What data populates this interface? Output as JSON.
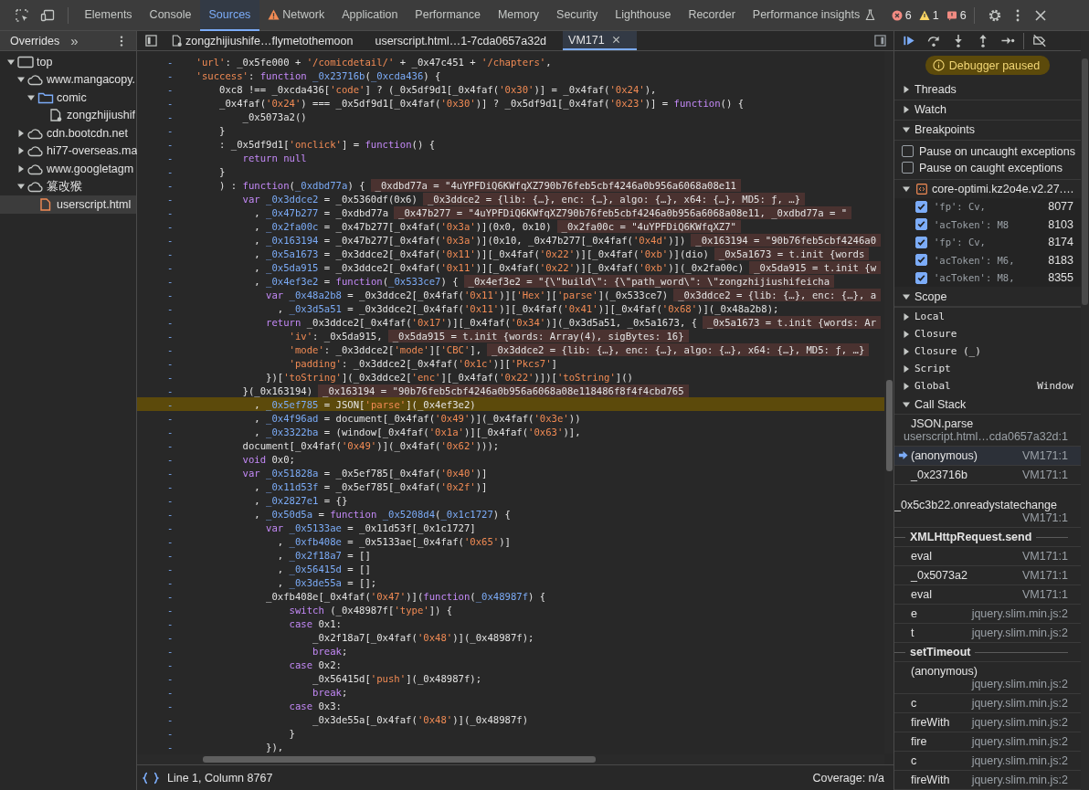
{
  "toolbar": {
    "tabs": [
      {
        "label": "Elements",
        "selected": false,
        "warning": false
      },
      {
        "label": "Console",
        "selected": false,
        "warning": false
      },
      {
        "label": "Sources",
        "selected": true,
        "warning": false
      },
      {
        "label": "Network",
        "selected": false,
        "warning": true
      },
      {
        "label": "Application",
        "selected": false,
        "warning": false
      },
      {
        "label": "Performance",
        "selected": false,
        "warning": false
      },
      {
        "label": "Memory",
        "selected": false,
        "warning": false
      },
      {
        "label": "Security",
        "selected": false,
        "warning": false
      },
      {
        "label": "Lighthouse",
        "selected": false,
        "warning": false
      },
      {
        "label": "Recorder",
        "selected": false,
        "warning": false
      },
      {
        "label": "Performance insights",
        "selected": false,
        "warning": false
      }
    ],
    "counters": [
      {
        "kind": "error",
        "count": "6"
      },
      {
        "kind": "warning",
        "count": "1"
      },
      {
        "kind": "issue",
        "count": "6"
      }
    ]
  },
  "navigator": {
    "tab": "Overrides",
    "more": "»",
    "tree": [
      {
        "label": "top",
        "kind": "frame",
        "expanded": true,
        "selected": false,
        "children": [
          {
            "label": "www.mangacopy.",
            "kind": "cloud",
            "expanded": true,
            "selected": false,
            "children": [
              {
                "label": "comic",
                "kind": "folder",
                "expanded": true,
                "selected": false,
                "children": [
                  {
                    "label": "zongzhijiushif",
                    "kind": "file",
                    "selected": false
                  }
                ]
              }
            ]
          },
          {
            "label": "cdn.bootcdn.net",
            "kind": "cloud",
            "expanded": false,
            "selected": false
          },
          {
            "label": "hi77-overseas.ma",
            "kind": "cloud",
            "expanded": false,
            "selected": false
          },
          {
            "label": "www.googletagm",
            "kind": "cloud",
            "expanded": false,
            "selected": false
          },
          {
            "label": "篡改猴",
            "kind": "cloud",
            "expanded": true,
            "selected": false,
            "children": [
              {
                "label": "userscript.html",
                "kind": "script",
                "selected": true
              }
            ]
          }
        ]
      }
    ]
  },
  "editor": {
    "tabs": [
      {
        "label": "zongzhijiushife…flymetothemoon",
        "kind": "file",
        "selected": false
      },
      {
        "label": "userscript.html…1-7cda0657a32d",
        "kind": "plain",
        "selected": false
      },
      {
        "label": "VM171",
        "kind": "plain",
        "selected": true
      }
    ],
    "lines": [
      {
        "gutter": "-",
        "paused": false,
        "segs": [
          {
            "kind": "string",
            "text": "    'url'"
          },
          {
            "kind": "plain",
            "text": ": _0x5fe000 + "
          },
          {
            "kind": "string",
            "text": "'/comicdetail/'"
          },
          {
            "kind": "plain",
            "text": " + _0x47c451 + "
          },
          {
            "kind": "string",
            "text": "'/chapters'"
          },
          {
            "kind": "plain",
            "text": ","
          }
        ]
      },
      {
        "gutter": "-",
        "paused": false,
        "segs": [
          {
            "kind": "string",
            "text": "    'success'"
          },
          {
            "kind": "plain",
            "text": ": "
          },
          {
            "kind": "keyword",
            "text": "function"
          },
          {
            "kind": "name",
            "text": " _0x23716b"
          },
          {
            "kind": "plain",
            "text": "("
          },
          {
            "kind": "name",
            "text": "_0xcda436"
          },
          {
            "kind": "plain",
            "text": ") {"
          }
        ]
      },
      {
        "gutter": "-",
        "paused": false,
        "segs": [
          {
            "kind": "plain",
            "text": "        0xc8 !== _0xcda436["
          },
          {
            "kind": "string",
            "text": "'code'"
          },
          {
            "kind": "plain",
            "text": "] ? (_0x5df9d1[_0x4faf("
          },
          {
            "kind": "string",
            "text": "'0x30'"
          },
          {
            "kind": "plain",
            "text": ")] = _0x4faf("
          },
          {
            "kind": "string",
            "text": "'0x24'"
          },
          {
            "kind": "plain",
            "text": "),"
          }
        ]
      },
      {
        "gutter": "-",
        "paused": false,
        "segs": [
          {
            "kind": "plain",
            "text": "        _0x4faf("
          },
          {
            "kind": "string",
            "text": "'0x24'"
          },
          {
            "kind": "plain",
            "text": ") === _0x5df9d1[_0x4faf("
          },
          {
            "kind": "string",
            "text": "'0x30'"
          },
          {
            "kind": "plain",
            "text": ")] ? _0x5df9d1[_0x4faf("
          },
          {
            "kind": "string",
            "text": "'0x23'"
          },
          {
            "kind": "plain",
            "text": ")] = "
          },
          {
            "kind": "keyword",
            "text": "function"
          },
          {
            "kind": "plain",
            "text": "() {"
          }
        ]
      },
      {
        "gutter": "-",
        "paused": false,
        "segs": [
          {
            "kind": "plain",
            "text": "            _0x5073a2()"
          }
        ]
      },
      {
        "gutter": "-",
        "paused": false,
        "segs": [
          {
            "kind": "plain",
            "text": "        }"
          }
        ]
      },
      {
        "gutter": "-",
        "paused": false,
        "segs": [
          {
            "kind": "plain",
            "text": "        : _0x5df9d1["
          },
          {
            "kind": "string",
            "text": "'onclick'"
          },
          {
            "kind": "plain",
            "text": "] = "
          },
          {
            "kind": "keyword",
            "text": "function"
          },
          {
            "kind": "plain",
            "text": "() {"
          }
        ]
      },
      {
        "gutter": "-",
        "paused": false,
        "segs": [
          {
            "kind": "keyword",
            "text": "            return null"
          }
        ]
      },
      {
        "gutter": "-",
        "paused": false,
        "segs": [
          {
            "kind": "plain",
            "text": "        }"
          }
        ]
      },
      {
        "gutter": "-",
        "paused": false,
        "segs": [
          {
            "kind": "plain",
            "text": "        ) : "
          },
          {
            "kind": "keyword",
            "text": "function"
          },
          {
            "kind": "plain",
            "text": "("
          },
          {
            "kind": "name",
            "text": "_0xdbd77a"
          },
          {
            "kind": "plain",
            "text": ") {"
          }
        ],
        "inline": "_0xdbd77a = \"4uYPFDiQ6KWfqXZ790b76feb5cbf4246a0b956a6068a08e11"
      },
      {
        "gutter": "-",
        "paused": false,
        "segs": [
          {
            "kind": "keyword",
            "text": "            var"
          },
          {
            "kind": "name",
            "text": " _0x3ddce2"
          },
          {
            "kind": "plain",
            "text": " = _0x5360df(0x6)"
          }
        ],
        "inline": "_0x3ddce2 = {lib: {…}, enc: {…}, algo: {…}, x64: {…}, MD5: ƒ, …}"
      },
      {
        "gutter": "-",
        "paused": false,
        "segs": [
          {
            "kind": "plain",
            "text": "              , "
          },
          {
            "kind": "name",
            "text": "_0x47b277"
          },
          {
            "kind": "plain",
            "text": " = _0xdbd77a"
          }
        ],
        "inline": "_0x47b277 = \"4uYPFDiQ6KWfqXZ790b76feb5cbf4246a0b956a6068a08e11, _0xdbd77a = \""
      },
      {
        "gutter": "-",
        "paused": false,
        "segs": [
          {
            "kind": "plain",
            "text": "              , "
          },
          {
            "kind": "name",
            "text": "_0x2fa00c"
          },
          {
            "kind": "plain",
            "text": " = _0x47b277[_0x4faf("
          },
          {
            "kind": "string",
            "text": "'0x3a'"
          },
          {
            "kind": "plain",
            "text": ")](0x0, 0x10)"
          }
        ],
        "inline": "_0x2fa00c = \"4uYPFDiQ6KWfqXZ7\""
      },
      {
        "gutter": "-",
        "paused": false,
        "segs": [
          {
            "kind": "plain",
            "text": "              , "
          },
          {
            "kind": "name",
            "text": "_0x163194"
          },
          {
            "kind": "plain",
            "text": " = _0x47b277[_0x4faf("
          },
          {
            "kind": "string",
            "text": "'0x3a'"
          },
          {
            "kind": "plain",
            "text": ")](0x10, _0x47b277[_0x4faf("
          },
          {
            "kind": "string",
            "text": "'0x4d'"
          },
          {
            "kind": "plain",
            "text": ")])"
          }
        ],
        "inline": "_0x163194 = \"90b76feb5cbf4246a0"
      },
      {
        "gutter": "-",
        "paused": false,
        "segs": [
          {
            "kind": "plain",
            "text": "              , "
          },
          {
            "kind": "name",
            "text": "_0x5a1673"
          },
          {
            "kind": "plain",
            "text": " = _0x3ddce2[_0x4faf("
          },
          {
            "kind": "string",
            "text": "'0x11'"
          },
          {
            "kind": "plain",
            "text": ")][_0x4faf("
          },
          {
            "kind": "string",
            "text": "'0x22'"
          },
          {
            "kind": "plain",
            "text": ")][_0x4faf("
          },
          {
            "kind": "string",
            "text": "'0xb'"
          },
          {
            "kind": "plain",
            "text": ")](dio)"
          }
        ],
        "inline": "_0x5a1673 = t.init {words"
      },
      {
        "gutter": "-",
        "paused": false,
        "segs": [
          {
            "kind": "plain",
            "text": "              , "
          },
          {
            "kind": "name",
            "text": "_0x5da915"
          },
          {
            "kind": "plain",
            "text": " = _0x3ddce2[_0x4faf("
          },
          {
            "kind": "string",
            "text": "'0x11'"
          },
          {
            "kind": "plain",
            "text": ")][_0x4faf("
          },
          {
            "kind": "string",
            "text": "'0x22'"
          },
          {
            "kind": "plain",
            "text": ")][_0x4faf("
          },
          {
            "kind": "string",
            "text": "'0xb'"
          },
          {
            "kind": "plain",
            "text": ")](_0x2fa00c)"
          }
        ],
        "inline": "_0x5da915 = t.init {w"
      },
      {
        "gutter": "-",
        "paused": false,
        "segs": [
          {
            "kind": "plain",
            "text": "              , "
          },
          {
            "kind": "name",
            "text": "_0x4ef3e2"
          },
          {
            "kind": "plain",
            "text": " = "
          },
          {
            "kind": "keyword",
            "text": "function"
          },
          {
            "kind": "plain",
            "text": "("
          },
          {
            "kind": "name",
            "text": "_0x533ce7"
          },
          {
            "kind": "plain",
            "text": ") {"
          }
        ],
        "inline": "_0x4ef3e2 = \"{\\\"build\\\": {\\\"path_word\\\": \\\"zongzhijiushifeicha"
      },
      {
        "gutter": "-",
        "paused": false,
        "segs": [
          {
            "kind": "keyword",
            "text": "                var"
          },
          {
            "kind": "name",
            "text": " _0x48a2b8"
          },
          {
            "kind": "plain",
            "text": " = _0x3ddce2[_0x4faf("
          },
          {
            "kind": "string",
            "text": "'0x11'"
          },
          {
            "kind": "plain",
            "text": ")]["
          },
          {
            "kind": "string",
            "text": "'Hex'"
          },
          {
            "kind": "plain",
            "text": "]["
          },
          {
            "kind": "string",
            "text": "'parse'"
          },
          {
            "kind": "plain",
            "text": "](_0x533ce7)"
          }
        ],
        "inline": "_0x3ddce2 = {lib: {…}, enc: {…}, a"
      },
      {
        "gutter": "-",
        "paused": false,
        "segs": [
          {
            "kind": "plain",
            "text": "                  , "
          },
          {
            "kind": "name",
            "text": "_0x3d5a51"
          },
          {
            "kind": "plain",
            "text": " = _0x3ddce2[_0x4faf("
          },
          {
            "kind": "string",
            "text": "'0x11'"
          },
          {
            "kind": "plain",
            "text": ")][_0x4faf("
          },
          {
            "kind": "string",
            "text": "'0x41'"
          },
          {
            "kind": "plain",
            "text": ")][_0x4faf("
          },
          {
            "kind": "string",
            "text": "'0x68'"
          },
          {
            "kind": "plain",
            "text": ")](_0x48a2b8);"
          }
        ]
      },
      {
        "gutter": "-",
        "paused": false,
        "segs": [
          {
            "kind": "keyword",
            "text": "                return"
          },
          {
            "kind": "plain",
            "text": " _0x3ddce2[_0x4faf("
          },
          {
            "kind": "string",
            "text": "'0x17'"
          },
          {
            "kind": "plain",
            "text": ")][_0x4faf("
          },
          {
            "kind": "string",
            "text": "'0x34'"
          },
          {
            "kind": "plain",
            "text": ")](_0x3d5a51, _0x5a1673, {"
          }
        ],
        "inline": "_0x5a1673 = t.init {words: Ar"
      },
      {
        "gutter": "-",
        "paused": false,
        "segs": [
          {
            "kind": "string",
            "text": "                    'iv'"
          },
          {
            "kind": "plain",
            "text": ": _0x5da915,"
          }
        ],
        "inline": "_0x5da915 = t.init {words: Array(4), sigBytes: 16}"
      },
      {
        "gutter": "-",
        "paused": false,
        "segs": [
          {
            "kind": "string",
            "text": "                    'mode'"
          },
          {
            "kind": "plain",
            "text": ": _0x3ddce2["
          },
          {
            "kind": "string",
            "text": "'mode'"
          },
          {
            "kind": "plain",
            "text": "]["
          },
          {
            "kind": "string",
            "text": "'CBC'"
          },
          {
            "kind": "plain",
            "text": "],"
          }
        ],
        "inline": "_0x3ddce2 = {lib: {…}, enc: {…}, algo: {…}, x64: {…}, MD5: ƒ, …}"
      },
      {
        "gutter": "-",
        "paused": false,
        "segs": [
          {
            "kind": "string",
            "text": "                    'padding'"
          },
          {
            "kind": "plain",
            "text": ": _0x3ddce2[_0x4faf("
          },
          {
            "kind": "string",
            "text": "'0x1c'"
          },
          {
            "kind": "plain",
            "text": ")]["
          },
          {
            "kind": "string",
            "text": "'Pkcs7'"
          },
          {
            "kind": "plain",
            "text": "]"
          }
        ]
      },
      {
        "gutter": "-",
        "paused": false,
        "segs": [
          {
            "kind": "plain",
            "text": "                })["
          },
          {
            "kind": "string",
            "text": "'toString'"
          },
          {
            "kind": "plain",
            "text": "](_0x3ddce2["
          },
          {
            "kind": "string",
            "text": "'enc'"
          },
          {
            "kind": "plain",
            "text": "][_0x4faf("
          },
          {
            "kind": "string",
            "text": "'0x22'"
          },
          {
            "kind": "plain",
            "text": ")])["
          },
          {
            "kind": "string",
            "text": "'toString'"
          },
          {
            "kind": "plain",
            "text": "]()"
          }
        ]
      },
      {
        "gutter": "-",
        "paused": false,
        "segs": [
          {
            "kind": "plain",
            "text": "            }(_0x163194)"
          }
        ],
        "inline": "_0x163194 = \"90b76feb5cbf4246a0b956a6068a08e118486f8f4f4cbd765"
      },
      {
        "gutter": "-",
        "paused": true,
        "segs": [
          {
            "kind": "plain",
            "text": "              , "
          },
          {
            "kind": "name",
            "text": "_0x5ef785"
          },
          {
            "kind": "plain",
            "text": " = JSON["
          },
          {
            "kind": "string",
            "text": "'parse'"
          },
          {
            "kind": "plain",
            "text": "](_0x4ef3e2)"
          }
        ]
      },
      {
        "gutter": "-",
        "paused": false,
        "segs": [
          {
            "kind": "plain",
            "text": "              , "
          },
          {
            "kind": "name",
            "text": "_0x4f96ad"
          },
          {
            "kind": "plain",
            "text": " = document[_0x4faf("
          },
          {
            "kind": "string",
            "text": "'0x49'"
          },
          {
            "kind": "plain",
            "text": ")](_0x4faf("
          },
          {
            "kind": "string",
            "text": "'0x3e'"
          },
          {
            "kind": "plain",
            "text": "))"
          }
        ]
      },
      {
        "gutter": "-",
        "paused": false,
        "segs": [
          {
            "kind": "plain",
            "text": "              , "
          },
          {
            "kind": "name",
            "text": "_0x3322ba"
          },
          {
            "kind": "plain",
            "text": " = (window[_0x4faf("
          },
          {
            "kind": "string",
            "text": "'0x1a'"
          },
          {
            "kind": "plain",
            "text": ")][_0x4faf("
          },
          {
            "kind": "string",
            "text": "'0x63'"
          },
          {
            "kind": "plain",
            "text": ")],"
          }
        ]
      },
      {
        "gutter": "-",
        "paused": false,
        "segs": [
          {
            "kind": "plain",
            "text": "            document[_0x4faf("
          },
          {
            "kind": "string",
            "text": "'0x49'"
          },
          {
            "kind": "plain",
            "text": ")](_0x4faf("
          },
          {
            "kind": "string",
            "text": "'0x62'"
          },
          {
            "kind": "plain",
            "text": ")));"
          }
        ]
      },
      {
        "gutter": "-",
        "paused": false,
        "segs": [
          {
            "kind": "keyword",
            "text": "            void"
          },
          {
            "kind": "plain",
            "text": " 0x0;"
          }
        ]
      },
      {
        "gutter": "-",
        "paused": false,
        "segs": [
          {
            "kind": "keyword",
            "text": "            var"
          },
          {
            "kind": "name",
            "text": " _0x51828a"
          },
          {
            "kind": "plain",
            "text": " = _0x5ef785[_0x4faf("
          },
          {
            "kind": "string",
            "text": "'0x40'"
          },
          {
            "kind": "plain",
            "text": ")]"
          }
        ]
      },
      {
        "gutter": "-",
        "paused": false,
        "segs": [
          {
            "kind": "plain",
            "text": "              , "
          },
          {
            "kind": "name",
            "text": "_0x11d53f"
          },
          {
            "kind": "plain",
            "text": " = _0x5ef785[_0x4faf("
          },
          {
            "kind": "string",
            "text": "'0x2f'"
          },
          {
            "kind": "plain",
            "text": ")]"
          }
        ]
      },
      {
        "gutter": "-",
        "paused": false,
        "segs": [
          {
            "kind": "plain",
            "text": "              , "
          },
          {
            "kind": "name",
            "text": "_0x2827e1"
          },
          {
            "kind": "plain",
            "text": " = {}"
          }
        ]
      },
      {
        "gutter": "-",
        "paused": false,
        "segs": [
          {
            "kind": "plain",
            "text": "              , "
          },
          {
            "kind": "name",
            "text": "_0x50d5a"
          },
          {
            "kind": "plain",
            "text": " = "
          },
          {
            "kind": "keyword",
            "text": "function"
          },
          {
            "kind": "name",
            "text": " _0x5208d4"
          },
          {
            "kind": "plain",
            "text": "("
          },
          {
            "kind": "name",
            "text": "_0x1c1727"
          },
          {
            "kind": "plain",
            "text": ") {"
          }
        ]
      },
      {
        "gutter": "-",
        "paused": false,
        "segs": [
          {
            "kind": "keyword",
            "text": "                var"
          },
          {
            "kind": "name",
            "text": " _0x5133ae"
          },
          {
            "kind": "plain",
            "text": " = _0x11d53f[_0x1c1727]"
          }
        ]
      },
      {
        "gutter": "-",
        "paused": false,
        "segs": [
          {
            "kind": "plain",
            "text": "                  , "
          },
          {
            "kind": "name",
            "text": "_0xfb408e"
          },
          {
            "kind": "plain",
            "text": " = _0x5133ae[_0x4faf("
          },
          {
            "kind": "string",
            "text": "'0x65'"
          },
          {
            "kind": "plain",
            "text": ")]"
          }
        ]
      },
      {
        "gutter": "-",
        "paused": false,
        "segs": [
          {
            "kind": "plain",
            "text": "                  , "
          },
          {
            "kind": "name",
            "text": "_0x2f18a7"
          },
          {
            "kind": "plain",
            "text": " = []"
          }
        ]
      },
      {
        "gutter": "-",
        "paused": false,
        "segs": [
          {
            "kind": "plain",
            "text": "                  , "
          },
          {
            "kind": "name",
            "text": "_0x56415d"
          },
          {
            "kind": "plain",
            "text": " = []"
          }
        ]
      },
      {
        "gutter": "-",
        "paused": false,
        "segs": [
          {
            "kind": "plain",
            "text": "                  , "
          },
          {
            "kind": "name",
            "text": "_0x3de55a"
          },
          {
            "kind": "plain",
            "text": " = [];"
          }
        ]
      },
      {
        "gutter": "-",
        "paused": false,
        "segs": [
          {
            "kind": "plain",
            "text": "                _0xfb408e[_0x4faf("
          },
          {
            "kind": "string",
            "text": "'0x47'"
          },
          {
            "kind": "plain",
            "text": ")]("
          },
          {
            "kind": "keyword",
            "text": "function"
          },
          {
            "kind": "plain",
            "text": "("
          },
          {
            "kind": "name",
            "text": "_0x48987f"
          },
          {
            "kind": "plain",
            "text": ") {"
          }
        ]
      },
      {
        "gutter": "-",
        "paused": false,
        "segs": [
          {
            "kind": "keyword",
            "text": "                    switch"
          },
          {
            "kind": "plain",
            "text": " (_0x48987f["
          },
          {
            "kind": "string",
            "text": "'type'"
          },
          {
            "kind": "plain",
            "text": "]) {"
          }
        ]
      },
      {
        "gutter": "-",
        "paused": false,
        "segs": [
          {
            "kind": "keyword",
            "text": "                    case"
          },
          {
            "kind": "plain",
            "text": " 0x1:"
          }
        ]
      },
      {
        "gutter": "-",
        "paused": false,
        "segs": [
          {
            "kind": "plain",
            "text": "                        _0x2f18a7[_0x4faf("
          },
          {
            "kind": "string",
            "text": "'0x48'"
          },
          {
            "kind": "plain",
            "text": ")](_0x48987f);"
          }
        ]
      },
      {
        "gutter": "-",
        "paused": false,
        "segs": [
          {
            "kind": "keyword",
            "text": "                        break"
          },
          {
            "kind": "plain",
            "text": ";"
          }
        ]
      },
      {
        "gutter": "-",
        "paused": false,
        "segs": [
          {
            "kind": "keyword",
            "text": "                    case"
          },
          {
            "kind": "plain",
            "text": " 0x2:"
          }
        ]
      },
      {
        "gutter": "-",
        "paused": false,
        "segs": [
          {
            "kind": "plain",
            "text": "                        _0x56415d["
          },
          {
            "kind": "string",
            "text": "'push'"
          },
          {
            "kind": "plain",
            "text": "](_0x48987f);"
          }
        ]
      },
      {
        "gutter": "-",
        "paused": false,
        "segs": [
          {
            "kind": "keyword",
            "text": "                        break"
          },
          {
            "kind": "plain",
            "text": ";"
          }
        ]
      },
      {
        "gutter": "-",
        "paused": false,
        "segs": [
          {
            "kind": "keyword",
            "text": "                    case"
          },
          {
            "kind": "plain",
            "text": " 0x3:"
          }
        ]
      },
      {
        "gutter": "-",
        "paused": false,
        "segs": [
          {
            "kind": "plain",
            "text": "                        _0x3de55a[_0x4faf("
          },
          {
            "kind": "string",
            "text": "'0x48'"
          },
          {
            "kind": "plain",
            "text": ")](_0x48987f)"
          }
        ]
      },
      {
        "gutter": "-",
        "paused": false,
        "segs": [
          {
            "kind": "plain",
            "text": "                    }"
          }
        ]
      },
      {
        "gutter": "-",
        "paused": false,
        "segs": [
          {
            "kind": "plain",
            "text": "                }),"
          }
        ]
      }
    ],
    "status": {
      "position": "Line 1, Column 8767",
      "coverage": "Coverage: n/a"
    }
  },
  "debugger": {
    "banner": "Debugger paused",
    "sections": [
      {
        "kind": "plain",
        "title": "Threads",
        "expanded": false
      },
      {
        "kind": "plain",
        "title": "Watch",
        "expanded": false
      },
      {
        "kind": "breakpoints",
        "title": "Breakpoints",
        "expanded": true,
        "options": [
          {
            "label": "Pause on uncaught exceptions",
            "checked": false
          },
          {
            "label": "Pause on caught exceptions",
            "checked": false
          }
        ],
        "file": {
          "name": "core-optimi.kz2o4e.v2.27.…",
          "expanded": true
        },
        "items": [
          {
            "code": "'fp': Cv,",
            "line": "8077",
            "checked": true
          },
          {
            "code": "'acToken': M8",
            "line": "8103",
            "checked": true
          },
          {
            "code": "'fp': Cv,",
            "line": "8174",
            "checked": true
          },
          {
            "code": "'acToken': M6,",
            "line": "8183",
            "checked": true
          },
          {
            "code": "'acToken': M8,",
            "line": "8355",
            "checked": true
          }
        ]
      },
      {
        "kind": "scope",
        "title": "Scope",
        "expanded": true,
        "items": [
          {
            "label": "Local"
          },
          {
            "label": "Closure"
          },
          {
            "label": "Closure (_)"
          },
          {
            "label": "Script"
          },
          {
            "label": "Global",
            "value": "Window"
          }
        ]
      },
      {
        "kind": "callstack",
        "title": "Call Stack",
        "expanded": true,
        "frames": [
          {
            "kind": "frame",
            "name": "JSON.parse",
            "location": "userscript.html…cda0657a32d:1",
            "current": false
          },
          {
            "kind": "frame",
            "name": "(anonymous)",
            "location": "VM171:1",
            "current": true
          },
          {
            "kind": "frame",
            "name": "_0x23716b",
            "location": "VM171:1",
            "current": false
          },
          {
            "kind": "frame",
            "name": "_0x5c3b22.onreadystatechange",
            "location": "VM171:1",
            "current": false
          },
          {
            "kind": "async",
            "name": "XMLHttpRequest.send"
          },
          {
            "kind": "frame",
            "name": "eval",
            "location": "VM171:1",
            "current": false
          },
          {
            "kind": "frame",
            "name": "_0x5073a2",
            "location": "VM171:1",
            "current": false
          },
          {
            "kind": "frame",
            "name": "eval",
            "location": "VM171:1",
            "current": false
          },
          {
            "kind": "frame",
            "name": "e",
            "location": "jquery.slim.min.js:2",
            "current": false
          },
          {
            "kind": "frame",
            "name": "t",
            "location": "jquery.slim.min.js:2",
            "current": false
          },
          {
            "kind": "async",
            "name": "setTimeout"
          },
          {
            "kind": "frame",
            "name": "(anonymous)",
            "location": "jquery.slim.min.js:2",
            "current": false
          },
          {
            "kind": "frame",
            "name": "c",
            "location": "jquery.slim.min.js:2",
            "current": false
          },
          {
            "kind": "frame",
            "name": "fireWith",
            "location": "jquery.slim.min.js:2",
            "current": false
          },
          {
            "kind": "frame",
            "name": "fire",
            "location": "jquery.slim.min.js:2",
            "current": false
          },
          {
            "kind": "frame",
            "name": "c",
            "location": "jquery.slim.min.js:2",
            "current": false
          },
          {
            "kind": "frame",
            "name": "fireWith",
            "location": "jquery.slim.min.js:2",
            "current": false
          }
        ]
      }
    ]
  }
}
